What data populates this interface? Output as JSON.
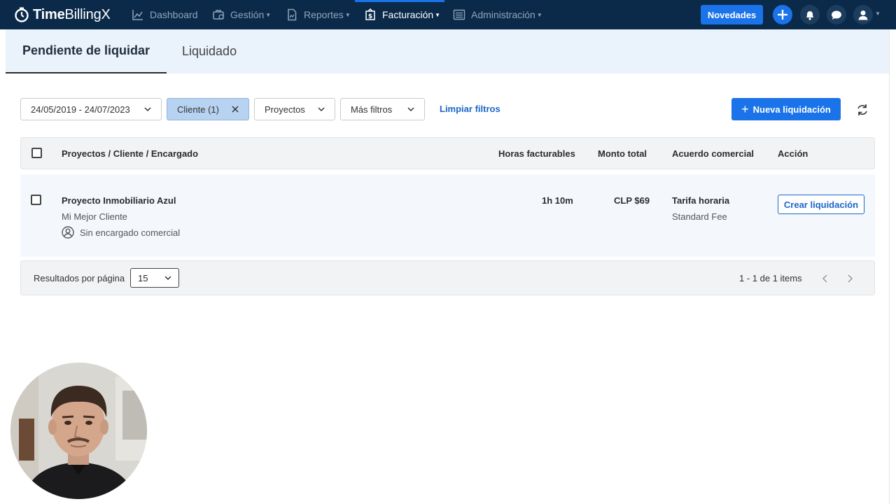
{
  "nav": {
    "brand_bold": "Time",
    "brand_thin": "Billing",
    "brand_x": "X",
    "items": [
      {
        "label": "Dashboard",
        "icon": "chart-line-icon"
      },
      {
        "label": "Gestión",
        "icon": "briefcase-icon"
      },
      {
        "label": "Reportes",
        "icon": "report-icon"
      },
      {
        "label": "Facturación",
        "icon": "billing-icon",
        "active": true
      },
      {
        "label": "Administración",
        "icon": "list-icon"
      }
    ],
    "novedades_label": "Novedades",
    "accent_color": "#1a73e8",
    "bar_color": "#0b2a4a"
  },
  "tabs": {
    "pending": "Pendiente de liquidar",
    "settled": "Liquidado"
  },
  "filters": {
    "date_range": "24/05/2019 - 24/07/2023",
    "client": "Cliente (1)",
    "projects": "Proyectos",
    "more": "Más filtros",
    "clear": "Limpiar filtros",
    "new_settlement": "Nueva liquidación"
  },
  "table": {
    "headers": {
      "project": "Proyectos / Cliente / Encargado",
      "hours": "Horas facturables",
      "amount": "Monto total",
      "agreement": "Acuerdo comercial",
      "action": "Acción"
    },
    "rows": [
      {
        "project": "Proyecto Inmobiliario Azul",
        "client": "Mi Mejor Cliente",
        "manager": "Sin encargado comercial",
        "hours": "1h 10m",
        "amount": "CLP $69",
        "agreement": "Tarifa horaria",
        "fee": "Standard Fee",
        "action": "Crear liquidación"
      }
    ]
  },
  "pagination": {
    "per_page_label": "Resultados por página",
    "per_page_value": "15",
    "range": "1 - 1 de 1 items"
  }
}
